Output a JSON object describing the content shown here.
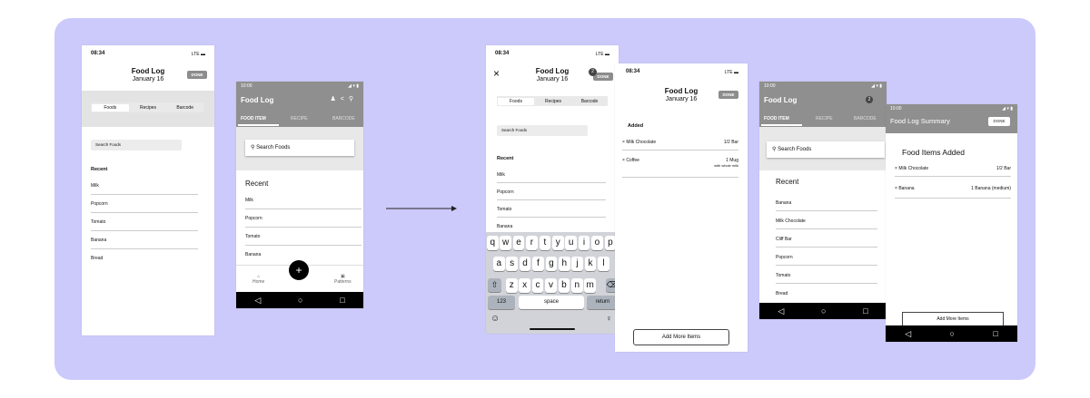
{
  "common": {
    "time_ios": "08:34",
    "time_android": "10:00",
    "signal": "LTE",
    "title": "Food Log",
    "date": "January 16",
    "done": "DONE",
    "close": "×",
    "badge": "2"
  },
  "ios": {
    "tabs": [
      "Foods",
      "Recipes",
      "Barcode"
    ],
    "search_placeholder": "Search Foods",
    "recent": "Recent",
    "items": [
      "Milk",
      "Popcorn",
      "Tomato",
      "Banana",
      "Bread"
    ]
  },
  "android": {
    "title": "Food Log",
    "tabs": [
      "FOOD ITEM",
      "RECIPE",
      "BARCODE"
    ],
    "search_placeholder": "Search Foods",
    "recent": "Recent",
    "items": [
      "Milk",
      "Popcorn",
      "Tomato",
      "Banana"
    ],
    "nav_home": "Home",
    "nav_patterns": "Patterns",
    "fab": "+"
  },
  "keyboard": {
    "row1": [
      "q",
      "w",
      "e",
      "r",
      "t",
      "y",
      "u",
      "i",
      "o",
      "p"
    ],
    "row2": [
      "a",
      "s",
      "d",
      "f",
      "g",
      "h",
      "j",
      "k",
      "l"
    ],
    "row3": [
      "z",
      "x",
      "c",
      "v",
      "b",
      "n",
      "m"
    ],
    "num": "123",
    "space": "space",
    "return": "return"
  },
  "added": {
    "header": "Added",
    "items": [
      {
        "name": "Milk Chocolate",
        "qty": "1/2 Bar",
        "note": ""
      },
      {
        "name": "Coffee",
        "qty": "1 Mug",
        "note": "with whole milk"
      }
    ],
    "add_more": "Add More Items"
  },
  "android2": {
    "items": [
      "Banana",
      "Milk Chocolate",
      "Cliff Bar",
      "Popcorn",
      "Tomato",
      "Bread"
    ]
  },
  "summary": {
    "title": "Food Log Summary",
    "header": "Food Items Added",
    "items": [
      {
        "name": "Milk Chocolate",
        "qty": "1/2 Bar"
      },
      {
        "name": "Banana",
        "qty": "1 Banana (medium)"
      }
    ],
    "add_more": "Add More Items"
  }
}
